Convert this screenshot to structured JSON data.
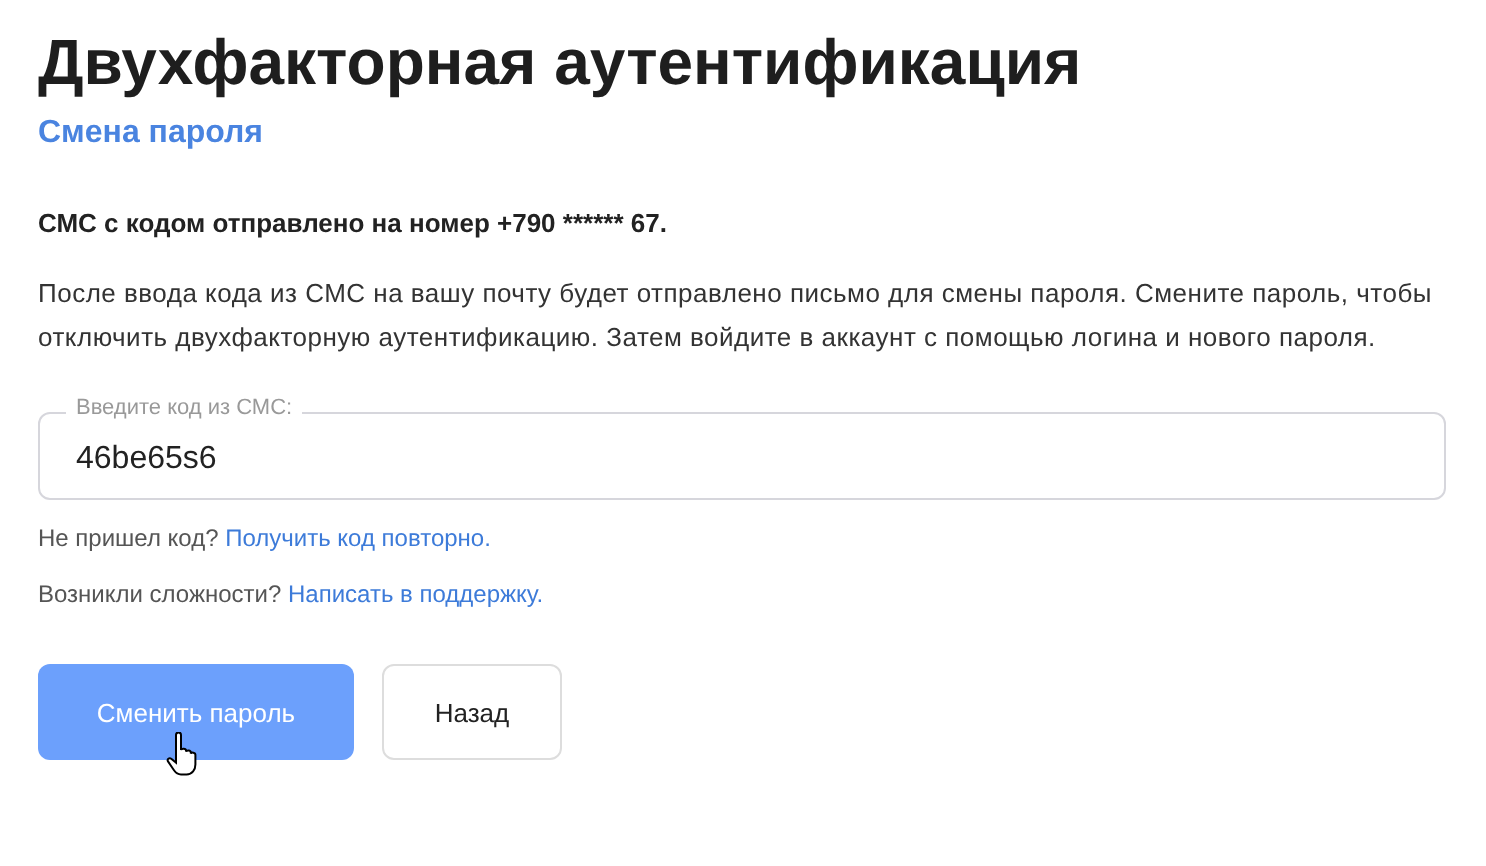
{
  "title": "Двухфакторная аутентификация",
  "subtitle": "Смена пароля",
  "notice": "СМС с кодом отправлено на номер +790 ****** 67.",
  "description": "После ввода кода из СМС на вашу почту будет отправлено письмо для смены пароля. Смените пароль, чтобы отключить двухфакторную аутентификацию. Затем войдите в аккаунт с помощью логина и нового пароля.",
  "code_field": {
    "label": "Введите код из СМС:",
    "value": "46be65s6"
  },
  "help_lines": [
    {
      "text": "Не пришел код?",
      "link": "Получить код повторно."
    },
    {
      "text": "Возникли сложности?",
      "link": "Написать в поддержку."
    }
  ],
  "buttons": [
    {
      "label": "Сменить пароль",
      "kind": "primary",
      "hovered": true
    },
    {
      "label": "Назад",
      "kind": "secondary",
      "hovered": false
    }
  ]
}
